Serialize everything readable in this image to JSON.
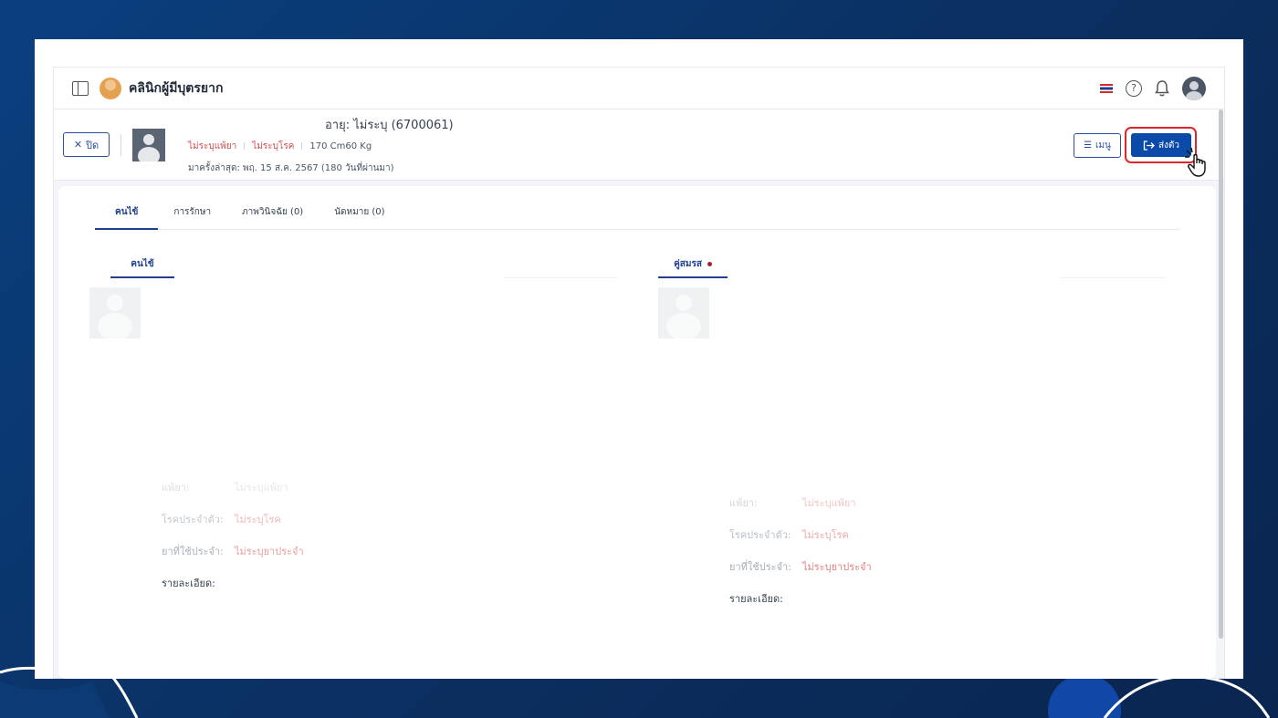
{
  "header": {
    "app_title": "คลินิกผู้มีบุตรยาก",
    "icons": [
      "sidebar-toggle-icon",
      "clinic-logo-icon",
      "thai-flag-icon",
      "help-icon",
      "bell-icon",
      "user-avatar-icon"
    ],
    "help_glyph": "?"
  },
  "patient": {
    "close_label": "ปิด",
    "age_label": "อายุ: ไม่ระบุ",
    "hn": "(6700061)",
    "allergy_tag": "ไม่ระบุแพ้ยา",
    "disease_tag": "ไม่ระบุโรค",
    "body_stats": "170 Cm60 Kg",
    "last_visit": "มาครั้งล่าสุด: พฤ. 15 ส.ค. 2567 (180 วันที่ผ่านมา)",
    "menu_label": "เมนู",
    "send_label": "ส่งตัว"
  },
  "tabs": [
    {
      "label": "คนไข้",
      "active": true
    },
    {
      "label": "การรักษา",
      "active": false
    },
    {
      "label": "ภาพวินิจฉัย (0)",
      "active": false
    },
    {
      "label": "นัดหมาย (0)",
      "active": false
    }
  ],
  "left_panel": {
    "tab_label": "คนไข้",
    "rows": [
      {
        "label": "",
        "value": ""
      },
      {
        "label": "แพ้ยา:",
        "value": "ไม่ระบุแพ้ยา"
      },
      {
        "label": "โรคประจำตัว:",
        "value": "ไม่ระบุโรค"
      },
      {
        "label": "ยาที่ใช้ประจำ:",
        "value": "ไม่ระบุยาประจำ"
      },
      {
        "label": "รายละเอียด:",
        "value": ""
      }
    ]
  },
  "right_panel": {
    "tab_label": "คู่สมรส",
    "rows": [
      {
        "label": "",
        "value": ""
      },
      {
        "label": "แพ้ยา:",
        "value": "ไม่ระบุแพ้ยา"
      },
      {
        "label": "โรคประจำตัว:",
        "value": "ไม่ระบุโรค"
      },
      {
        "label": "ยาที่ใช้ประจำ:",
        "value": "ไม่ระบุยาประจำ"
      },
      {
        "label": "รายละเอียด:",
        "value": ""
      }
    ]
  },
  "colors": {
    "primary": "#0b4aa8",
    "highlight_border": "#e0262b",
    "tag_red": "#d14a4a"
  }
}
